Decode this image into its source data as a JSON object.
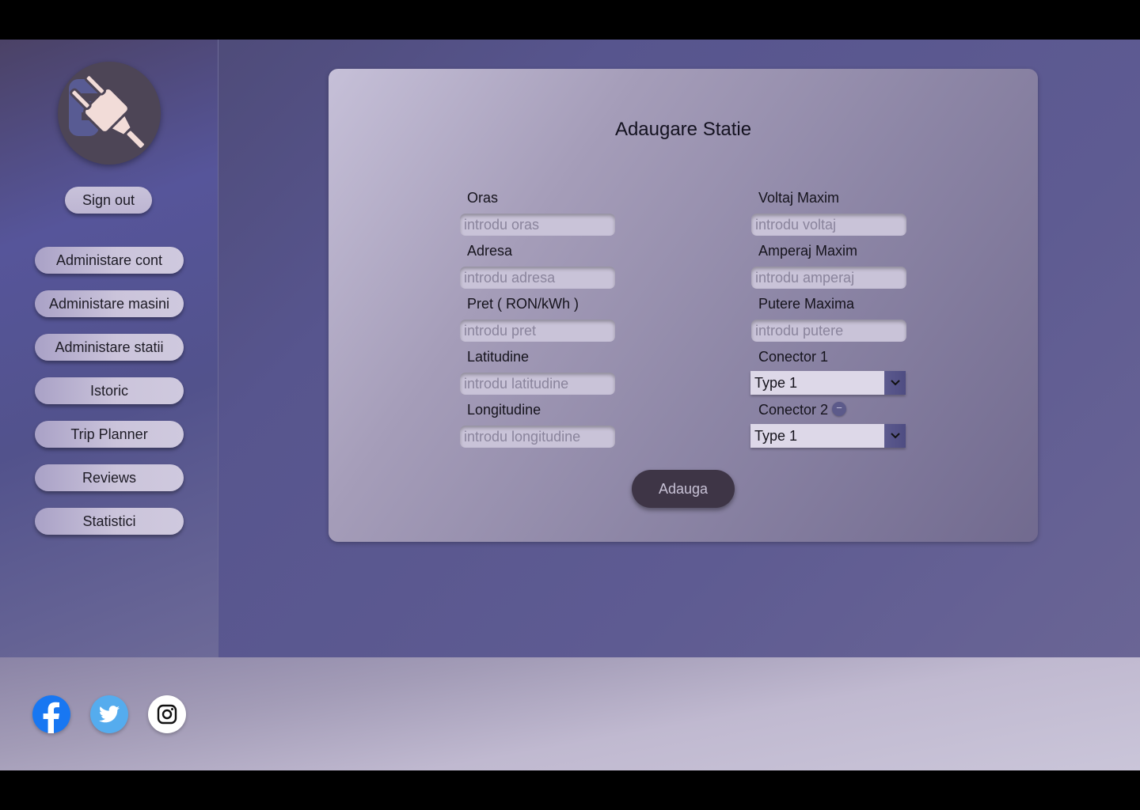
{
  "sidebar": {
    "logo_icon": "plug-logo-icon",
    "sign_out_label": "Sign out",
    "nav_items": [
      {
        "label": "Administare cont"
      },
      {
        "label": "Administare masini"
      },
      {
        "label": "Administare statii"
      },
      {
        "label": "Istoric"
      },
      {
        "label": "Trip Planner"
      },
      {
        "label": "Reviews"
      },
      {
        "label": "Statistici"
      }
    ]
  },
  "form": {
    "title": "Adaugare Statie",
    "left_fields": [
      {
        "label": "Oras",
        "placeholder": "introdu oras",
        "value": ""
      },
      {
        "label": "Adresa",
        "placeholder": "introdu adresa",
        "value": ""
      },
      {
        "label": "Pret ( RON/kWh )",
        "placeholder": "introdu pret",
        "value": ""
      },
      {
        "label": "Latitudine",
        "placeholder": "introdu latitudine",
        "value": ""
      },
      {
        "label": "Longitudine",
        "placeholder": "introdu longitudine",
        "value": ""
      }
    ],
    "right_fields": [
      {
        "label": "Voltaj Maxim",
        "placeholder": "introdu voltaj",
        "value": ""
      },
      {
        "label": "Amperaj Maxim",
        "placeholder": "introdu amperaj",
        "value": ""
      },
      {
        "label": "Putere Maxima",
        "placeholder": "introdu putere",
        "value": ""
      }
    ],
    "connectors": [
      {
        "label": "Conector 1",
        "selected": "Type 1"
      },
      {
        "label": "Conector 2",
        "selected": "Type 1",
        "remove_symbol": "−"
      }
    ],
    "submit_label": "Adauga"
  },
  "footer": {
    "social": [
      {
        "icon": "facebook-icon",
        "color": "#1877f2"
      },
      {
        "icon": "twitter-icon",
        "color": "#55acee"
      },
      {
        "icon": "instagram-icon",
        "color": "#ffffff"
      }
    ]
  },
  "colors": {
    "accent": "#57558e",
    "button_dark": "#3e3546",
    "pill": "#c8c2da"
  }
}
